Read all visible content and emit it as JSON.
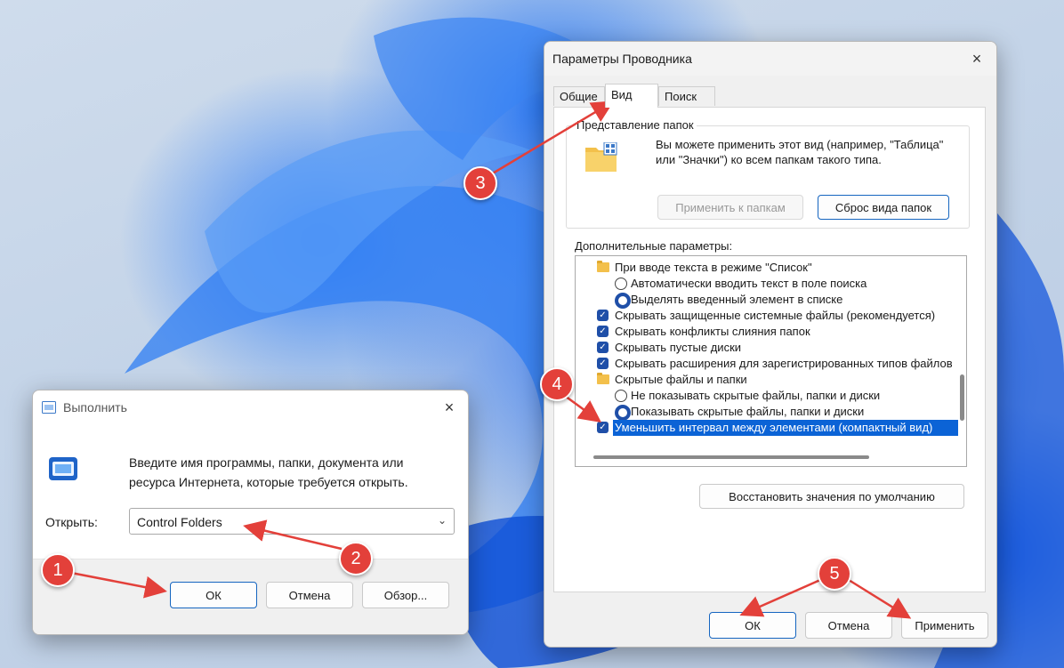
{
  "run_dialog": {
    "title": "Выполнить",
    "close_glyph": "×",
    "description": "Введите имя программы, папки, документа или ресурса Интернета, которые требуется открыть.",
    "open_label": "Открыть:",
    "open_value": "Control Folders",
    "buttons": {
      "ok": "ОК",
      "cancel": "Отмена",
      "browse": "Обзор..."
    }
  },
  "folder_options": {
    "title": "Параметры Проводника",
    "close_glyph": "×",
    "tabs": [
      "Общие",
      "Вид",
      "Поиск"
    ],
    "active_tab": "Вид",
    "folder_views": {
      "label": "Представление папок",
      "text": "Вы можете применить этот вид (например, \"Таблица\" или \"Значки\") ко всем папкам такого типа.",
      "apply_button": "Применить к папкам",
      "reset_button": "Сброс вида папок"
    },
    "advanced_label": "Дополнительные параметры:",
    "advanced_items": [
      {
        "type": "folder",
        "label": "При вводе текста в режиме \"Список\""
      },
      {
        "type": "radio",
        "checked": false,
        "label": "Автоматически вводить текст в поле поиска"
      },
      {
        "type": "radio",
        "checked": true,
        "label": "Выделять введенный элемент в списке"
      },
      {
        "type": "checkbox",
        "checked": true,
        "label": "Скрывать защищенные системные файлы (рекомендуется)"
      },
      {
        "type": "checkbox",
        "checked": true,
        "label": "Скрывать конфликты слияния папок"
      },
      {
        "type": "checkbox",
        "checked": true,
        "label": "Скрывать пустые диски"
      },
      {
        "type": "checkbox",
        "checked": true,
        "label": "Скрывать расширения для зарегистрированных типов файлов"
      },
      {
        "type": "folder",
        "label": "Скрытые файлы и папки"
      },
      {
        "type": "radio",
        "checked": false,
        "label": "Не показывать скрытые файлы, папки и диски"
      },
      {
        "type": "radio",
        "checked": true,
        "label": "Показывать скрытые файлы, папки и диски"
      },
      {
        "type": "checkbox",
        "checked": true,
        "selected": true,
        "label": "Уменьшить интервал между элементами (компактный вид)"
      }
    ],
    "restore_button": "Восстановить значения по умолчанию",
    "buttons": {
      "ok": "ОК",
      "cancel": "Отмена",
      "apply": "Применить"
    }
  },
  "markers": [
    "1",
    "2",
    "3",
    "4",
    "5"
  ],
  "colors": {
    "marker": "#e3403a",
    "accent": "#1f4fa8",
    "selection": "#0b63d6"
  }
}
